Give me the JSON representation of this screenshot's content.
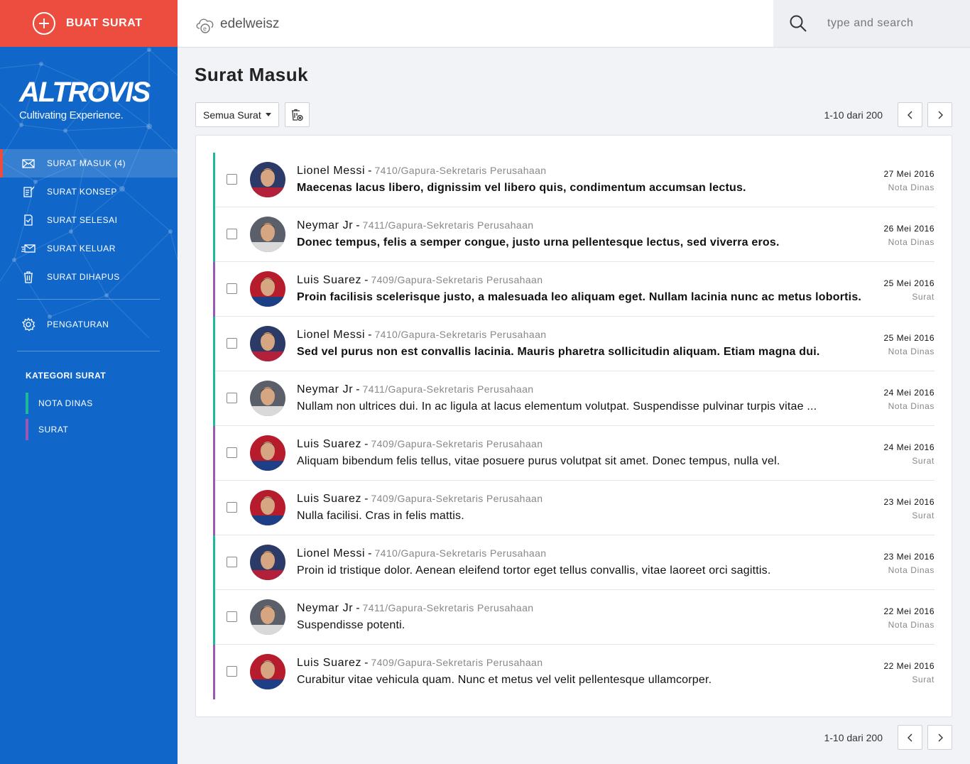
{
  "compose": {
    "label": "BUAT SURAT"
  },
  "brand": {
    "name": "ALTROVIS",
    "tagline": "Cultivating Experience."
  },
  "nav": [
    {
      "label": "SURAT MASUK (4)",
      "icon": "inbox-envelope-icon"
    },
    {
      "label": "SURAT KONSEP",
      "icon": "draft-icon"
    },
    {
      "label": "SURAT SELESAI",
      "icon": "done-document-icon"
    },
    {
      "label": "SURAT KELUAR",
      "icon": "outbox-envelope-icon"
    },
    {
      "label": "SURAT DIHAPUS",
      "icon": "trash-icon"
    }
  ],
  "settings": {
    "label": "PENGATURAN"
  },
  "categories": {
    "title": "KATEGORI SURAT",
    "items": [
      {
        "label": "NOTA DINAS",
        "color": "#1fb89a"
      },
      {
        "label": "SURAT",
        "color": "#9b59b6"
      }
    ]
  },
  "topbar": {
    "org": "edelweisz",
    "search_placeholder": "type and search"
  },
  "page": {
    "title": "Surat Masuk"
  },
  "toolbar": {
    "filter_label": "Semua Surat"
  },
  "pagination": {
    "range": "1-10 dari 200"
  },
  "colors": {
    "sidebar": "#1067c9",
    "compose": "#ec4d3e",
    "nota_dinas": "#1fb89a",
    "surat": "#9b59b6"
  },
  "messages": [
    {
      "sender": "Lionel Messi",
      "ref": "7410/Gapura-Sekretaris Perusahaan",
      "subject": "Maecenas lacus libero, dignissim vel libero quis, condimentum accumsan lectus.",
      "date": "27 Mei 2016",
      "type": "Nota Dinas",
      "unread": true
    },
    {
      "sender": "Neymar Jr",
      "ref": "7411/Gapura-Sekretaris Perusahaan",
      "subject": "Donec tempus, felis a semper congue, justo urna pellentesque lectus, sed viverra eros.",
      "date": "26 Mei 2016",
      "type": "Nota Dinas",
      "unread": true
    },
    {
      "sender": "Luis Suarez",
      "ref": "7409/Gapura-Sekretaris Perusahaan",
      "subject": "Proin facilisis scelerisque justo, a malesuada leo aliquam eget. Nullam lacinia nunc ac metus lobortis.",
      "date": "25 Mei 2016",
      "type": "Surat",
      "unread": true
    },
    {
      "sender": "Lionel Messi",
      "ref": "7410/Gapura-Sekretaris Perusahaan",
      "subject": "Sed vel purus non est convallis lacinia. Mauris pharetra sollicitudin aliquam. Etiam magna dui.",
      "date": "25 Mei 2016",
      "type": "Nota Dinas",
      "unread": true
    },
    {
      "sender": "Neymar Jr",
      "ref": "7411/Gapura-Sekretaris Perusahaan",
      "subject": "Nullam non ultrices dui. In ac ligula at lacus elementum volutpat. Suspendisse pulvinar turpis vitae ...",
      "date": "24 Mei 2016",
      "type": "Nota Dinas",
      "unread": false
    },
    {
      "sender": "Luis Suarez",
      "ref": "7409/Gapura-Sekretaris Perusahaan",
      "subject": "Aliquam bibendum felis tellus, vitae posuere purus volutpat sit amet. Donec tempus, nulla vel.",
      "date": "24 Mei 2016",
      "type": "Surat",
      "unread": false
    },
    {
      "sender": "Luis Suarez",
      "ref": "7409/Gapura-Sekretaris Perusahaan",
      "subject": "Nulla facilisi. Cras in felis mattis.",
      "date": "23 Mei 2016",
      "type": "Surat",
      "unread": false
    },
    {
      "sender": "Lionel Messi",
      "ref": "7410/Gapura-Sekretaris Perusahaan",
      "subject": "Proin id tristique dolor. Aenean eleifend tortor eget tellus convallis, vitae laoreet orci sagittis.",
      "date": "23 Mei 2016",
      "type": "Nota Dinas",
      "unread": false
    },
    {
      "sender": "Neymar Jr",
      "ref": "7411/Gapura-Sekretaris Perusahaan",
      "subject": "Suspendisse potenti.",
      "date": "22 Mei 2016",
      "type": "Nota Dinas",
      "unread": false
    },
    {
      "sender": "Luis Suarez",
      "ref": "7409/Gapura-Sekretaris Perusahaan",
      "subject": "Curabitur vitae vehicula quam. Nunc et metus vel velit pellentesque ullamcorper.",
      "date": "22 Mei 2016",
      "type": "Surat",
      "unread": false
    }
  ]
}
